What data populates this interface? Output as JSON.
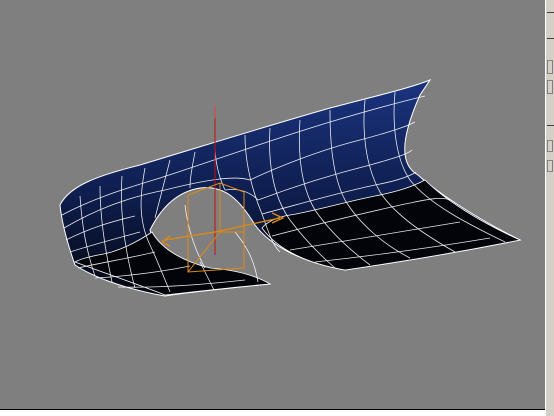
{
  "viewport": {
    "background_color": "#7f7f7f",
    "surface_colors": {
      "face_lit": "#152a6a",
      "face_dark": "#050a1a",
      "wire": "#ffffff",
      "gizmo_axis": "#e08a10",
      "z_axis": "#c01010"
    },
    "icons": [
      "transform-gizmo-icon",
      "world-axis-icon"
    ]
  }
}
